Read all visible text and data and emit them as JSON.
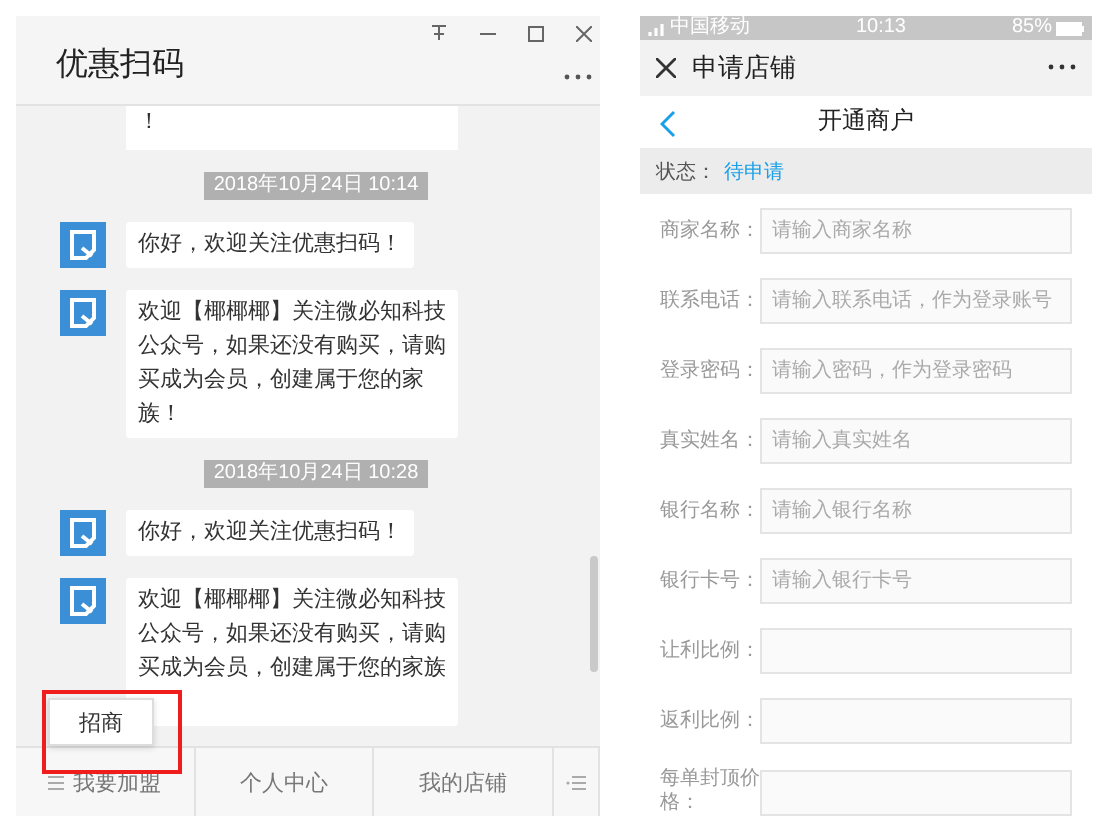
{
  "chat_window": {
    "title": "优惠扫码",
    "messages": [
      {
        "kind": "partial",
        "text": "！"
      },
      {
        "kind": "time",
        "text": "2018年10月24日 10:14"
      },
      {
        "kind": "bubble",
        "text": "你好，欢迎关注优惠扫码！"
      },
      {
        "kind": "bubble",
        "text": "欢迎【椰椰椰】关注微必知科技公众号，如果还没有购买，请购买成为会员，创建属于您的家族！"
      },
      {
        "kind": "time",
        "text": "2018年10月24日 10:28"
      },
      {
        "kind": "bubble",
        "text": "你好，欢迎关注优惠扫码！"
      },
      {
        "kind": "covered",
        "text": "欢迎【椰椰椰】关注微必知科技公众号，如果还没有购买，请购买成为会员，创建属于您的家族"
      }
    ],
    "popup": {
      "label": "招商",
      "highlighted": true
    },
    "menu": [
      {
        "label": "我要加盟",
        "has_list_icon": true
      },
      {
        "label": "个人中心",
        "has_list_icon": false
      },
      {
        "label": "我的店铺",
        "has_list_icon": false
      }
    ]
  },
  "phone": {
    "status_bar": {
      "carrier": "中国移动",
      "time": "10:13",
      "battery": "85%"
    },
    "title": "申请店铺",
    "page_title": "开通商户",
    "status_label": "状态：",
    "status_value": "待申请",
    "fields": [
      {
        "label": "商家名称：",
        "placeholder": "请输入商家名称"
      },
      {
        "label": "联系电话：",
        "placeholder": "请输入联系电话，作为登录账号"
      },
      {
        "label": "登录密码：",
        "placeholder": "请输入密码，作为登录密码"
      },
      {
        "label": "真实姓名：",
        "placeholder": "请输入真实姓名"
      },
      {
        "label": "银行名称：",
        "placeholder": "请输入银行名称"
      },
      {
        "label": "银行卡号：",
        "placeholder": "请输入银行卡号"
      },
      {
        "label": "让利比例："
      },
      {
        "label": "返利比例："
      },
      {
        "label": "每单封顶价格："
      }
    ]
  }
}
